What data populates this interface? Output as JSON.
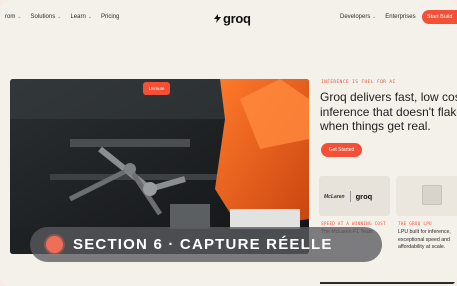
{
  "nav": {
    "items_left": [
      {
        "label": "rom",
        "has_dropdown": true
      },
      {
        "label": "Solutions",
        "has_dropdown": true
      },
      {
        "label": "Learn",
        "has_dropdown": true
      },
      {
        "label": "Pricing",
        "has_dropdown": false
      }
    ],
    "logo_text": "groq",
    "items_right": [
      {
        "label": "Developers",
        "has_dropdown": true
      },
      {
        "label": "Enterprises",
        "has_dropdown": false
      }
    ],
    "cta_label": "Start Build"
  },
  "hero": {
    "video_button": "Unmute",
    "eyebrow": "INFERENCE IS FUEL FOR AI",
    "headline": "Groq delivers fast, low cost inference that doesn't flake when things get real.",
    "cta_label": "Get Started"
  },
  "cards": [
    {
      "tag": "SPEED AT A WINNING COST",
      "logo_left": "McLaren",
      "logo_right": "groq",
      "text": "The McLaren F1 Team"
    },
    {
      "tag": "THE GROQ LPU",
      "text": "LPU built for inference, exceptional speed and affordability at scale."
    }
  ],
  "overlay": {
    "label": "SECTION 6 · CAPTURE RÉELLE"
  },
  "colors": {
    "accent": "#f55036",
    "background": "#f4f1ea",
    "overlay": "#5a5a5f"
  }
}
